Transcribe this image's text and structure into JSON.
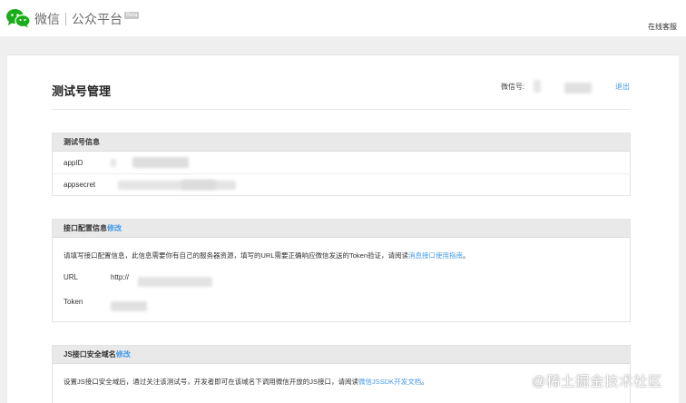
{
  "header": {
    "app_name": "微信",
    "platform_name": "公众平台",
    "beta_badge": "Beta",
    "online_service": "在线客服"
  },
  "page": {
    "title": "测试号管理",
    "wechat_id_label": "微信号:",
    "logout_label": "退出"
  },
  "test_account_info": {
    "heading": "测试号信息",
    "appid_label": "appID",
    "appsecret_label": "appsecret"
  },
  "interface_config": {
    "heading": "接口配置信息",
    "edit_label": "修改",
    "description": "请填写接口配置信息，此信息需要你有自己的服务器资源，填写的URL需要正确响应微信发送的Token验证，请阅读",
    "guide_link": "消息接口使用指南",
    "description_end": "。",
    "url_label": "URL",
    "url_value_prefix": "http://",
    "token_label": "Token"
  },
  "js_domain": {
    "heading": "JS接口安全域名",
    "edit_label": "修改",
    "description": "设置JS接口安全域后，通过关注该测试号，开发者即可在该域名下调用微信开放的JS接口，请阅读",
    "doc_link": "微信JSSDK开发文档",
    "description_end": "。"
  },
  "watermark": "@稀土掘金技术社区",
  "colors": {
    "link": "#459ae9",
    "wechat_green": "#1aad19",
    "band": "#efefef"
  }
}
